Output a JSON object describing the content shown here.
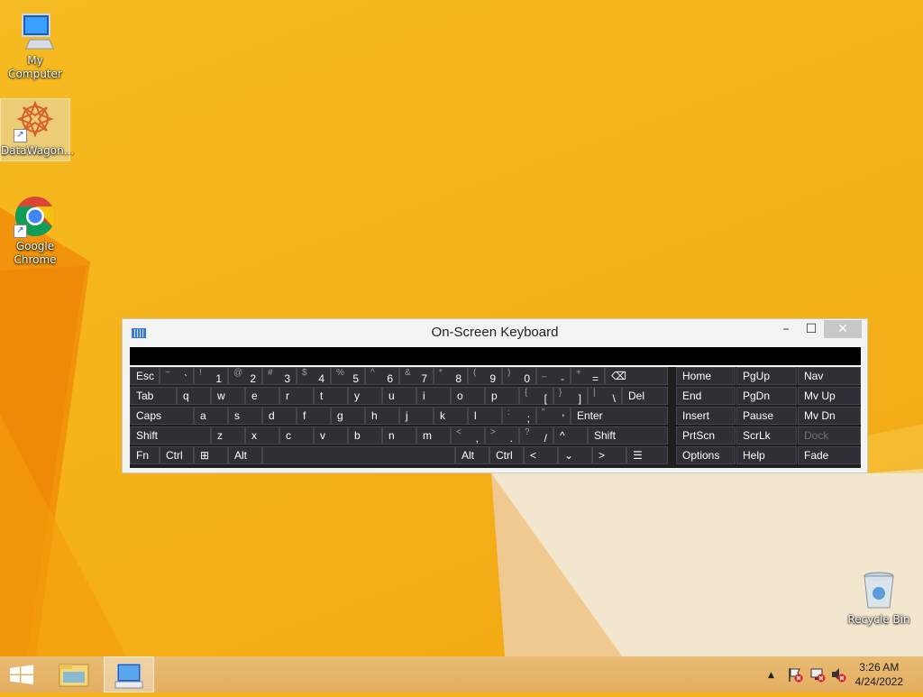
{
  "desktop": {
    "icons": [
      {
        "label": "My Computer"
      },
      {
        "label": "DataWagon..."
      },
      {
        "label": "Google Chrome"
      },
      {
        "label": "Recycle Bin"
      }
    ]
  },
  "osk": {
    "title": "On-Screen Keyboard",
    "minimize": "–",
    "maximize": "☐",
    "close": "✕",
    "rows": [
      [
        {
          "main": "Esc"
        },
        {
          "sub": "~",
          "main": "`"
        },
        {
          "sub": "!",
          "main": "1"
        },
        {
          "sub": "@",
          "main": "2"
        },
        {
          "sub": "#",
          "main": "3"
        },
        {
          "sub": "$",
          "main": "4"
        },
        {
          "sub": "%",
          "main": "5"
        },
        {
          "sub": "^",
          "main": "6"
        },
        {
          "sub": "&",
          "main": "7"
        },
        {
          "sub": "*",
          "main": "8"
        },
        {
          "sub": "(",
          "main": "9"
        },
        {
          "sub": ")",
          "main": "0"
        },
        {
          "sub": "_",
          "main": "-"
        },
        {
          "sub": "+",
          "main": "="
        },
        {
          "main": "⌫"
        }
      ],
      [
        {
          "main": "Tab"
        },
        {
          "main": "q"
        },
        {
          "main": "w"
        },
        {
          "main": "e"
        },
        {
          "main": "r"
        },
        {
          "main": "t"
        },
        {
          "main": "y"
        },
        {
          "main": "u"
        },
        {
          "main": "i"
        },
        {
          "main": "o"
        },
        {
          "main": "p"
        },
        {
          "sub": "{",
          "main": "["
        },
        {
          "sub": "}",
          "main": "]"
        },
        {
          "sub": "|",
          "main": "\\"
        },
        {
          "main": "Del"
        }
      ],
      [
        {
          "main": "Caps"
        },
        {
          "main": "a"
        },
        {
          "main": "s"
        },
        {
          "main": "d"
        },
        {
          "main": "f"
        },
        {
          "main": "g"
        },
        {
          "main": "h"
        },
        {
          "main": "j"
        },
        {
          "main": "k"
        },
        {
          "main": "l"
        },
        {
          "sub": ":",
          "main": ";"
        },
        {
          "sub": "\"",
          "main": "'"
        },
        {
          "main": "Enter"
        }
      ],
      [
        {
          "main": "Shift"
        },
        {
          "main": "z"
        },
        {
          "main": "x"
        },
        {
          "main": "c"
        },
        {
          "main": "v"
        },
        {
          "main": "b"
        },
        {
          "main": "n"
        },
        {
          "main": "m"
        },
        {
          "sub": "<",
          "main": ","
        },
        {
          "sub": ">",
          "main": "."
        },
        {
          "sub": "?",
          "main": "/"
        },
        {
          "main": "^"
        },
        {
          "main": "Shift"
        }
      ],
      [
        {
          "main": "Fn"
        },
        {
          "main": "Ctrl"
        },
        {
          "main": "⊞"
        },
        {
          "main": "Alt"
        },
        {
          "main": ""
        },
        {
          "main": "Alt"
        },
        {
          "main": "Ctrl"
        },
        {
          "main": "<"
        },
        {
          "main": "⌄"
        },
        {
          "main": ">"
        },
        {
          "main": "☰"
        }
      ]
    ],
    "nav_rows": [
      [
        "Home",
        "PgUp",
        "Nav"
      ],
      [
        "End",
        "PgDn",
        "Mv Up"
      ],
      [
        "Insert",
        "Pause",
        "Mv Dn"
      ],
      [
        "PrtScn",
        "ScrLk",
        "Dock"
      ],
      [
        "Options",
        "Help",
        "Fade"
      ]
    ]
  },
  "taskbar": {
    "clock_time": "3:26 AM",
    "clock_date": "4/24/2022",
    "tray_up_arrow": "▲"
  }
}
